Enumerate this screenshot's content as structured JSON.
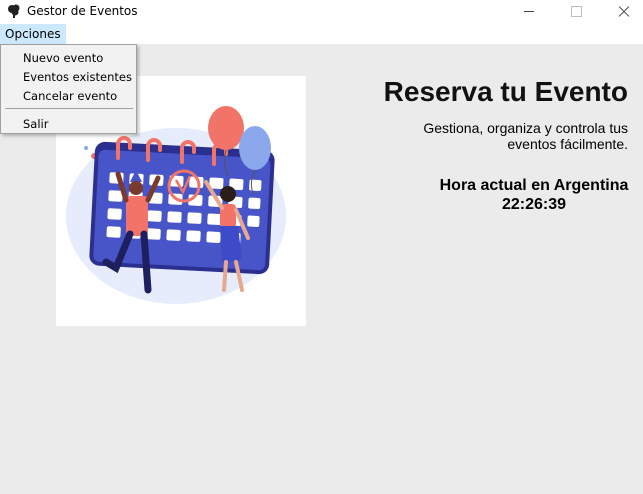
{
  "window": {
    "title": "Gestor de Eventos"
  },
  "menubar": {
    "opciones_label": "Opciones"
  },
  "dropdown": {
    "items": [
      {
        "label": "Nuevo evento"
      },
      {
        "label": "Eventos existentes"
      },
      {
        "label": "Cancelar evento"
      },
      {
        "label": "Salir"
      }
    ]
  },
  "main": {
    "heading": "Reserva tu Evento",
    "subtitle": "Gestiona, organiza y controla tus eventos fácilmente.",
    "time_label": "Hora actual en Argentina",
    "time_value": "22:26:39"
  },
  "illustration": {
    "icon": "calendar-celebration-illustration"
  },
  "colors": {
    "menu_highlight": "#cce8ff",
    "background": "#ebebeb",
    "balloon_red": "#f27468",
    "balloon_blue": "#8ba8ec",
    "calendar_navy": "#2b2f8f"
  }
}
